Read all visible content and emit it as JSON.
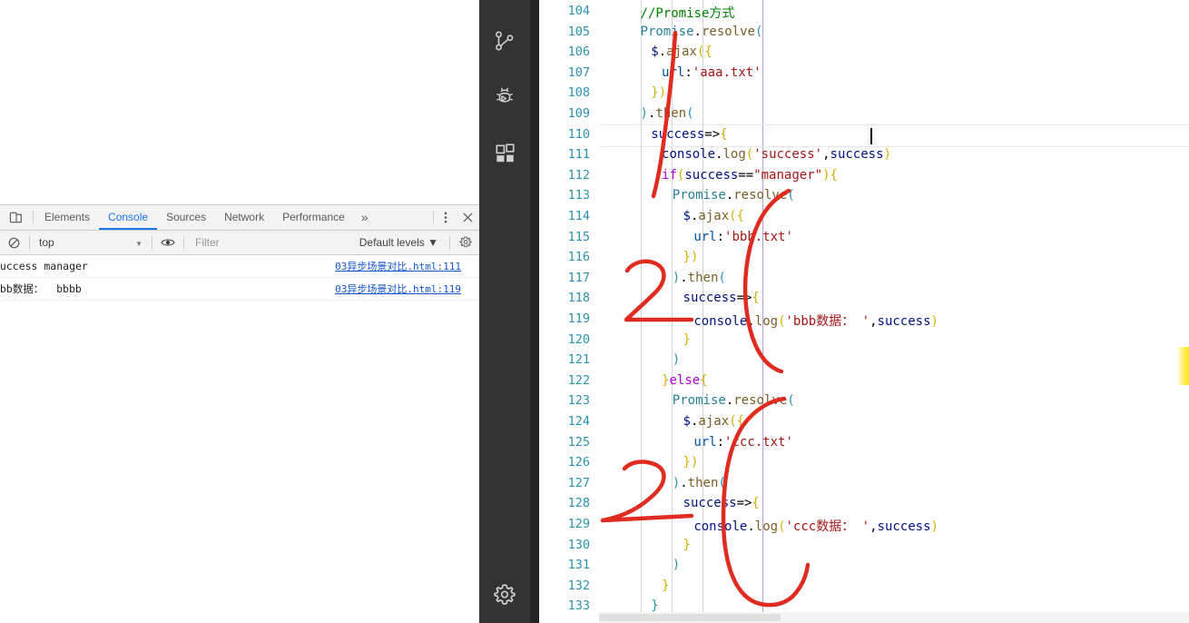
{
  "devtools": {
    "inspect_icon": "device-toolbar-icon",
    "tabs": [
      {
        "label": "Elements",
        "active": false
      },
      {
        "label": "Console",
        "active": true
      },
      {
        "label": "Sources",
        "active": false
      },
      {
        "label": "Network",
        "active": false
      },
      {
        "label": "Performance",
        "active": false
      }
    ],
    "overflow_label": "»",
    "kebab_icon": "more-vertical-icon",
    "close_icon": "close-icon",
    "filterbar": {
      "clear_icon": "clear-console-icon",
      "context": "top",
      "context_caret": "▼",
      "eye_icon": "eye-icon",
      "filter_placeholder": "Filter",
      "levels": "Default levels ▼",
      "gear_icon": "settings-gear-icon"
    },
    "messages": [
      {
        "text": "success manager",
        "source": "03异步场景对比.html:111"
      },
      {
        "text": "bbb数据：  bbbb",
        "source": "03异步场景对比.html:119"
      }
    ]
  },
  "activitybar": {
    "items": [
      {
        "name": "source-control-icon"
      },
      {
        "name": "run-and-debug-icon"
      },
      {
        "name": "extensions-icon"
      }
    ],
    "bottom": [
      {
        "name": "settings-gear-icon"
      }
    ]
  },
  "editor": {
    "first_line_number": 104,
    "line_numbers": [
      104,
      105,
      106,
      107,
      108,
      109,
      110,
      111,
      112,
      113,
      114,
      115,
      116,
      117,
      118,
      119,
      120,
      121,
      122,
      123,
      124,
      125,
      126,
      127,
      128,
      129,
      130,
      131,
      132,
      133
    ],
    "cursor_line": 110,
    "lines": [
      {
        "n": 104,
        "indent": 2,
        "tokens": [
          {
            "t": "//Promise方式",
            "c": "tk-cmt"
          }
        ]
      },
      {
        "n": 105,
        "indent": 2,
        "tokens": [
          {
            "t": "Promise",
            "c": "tk-cls"
          },
          {
            "t": ".",
            "c": "tk-plain"
          },
          {
            "t": "resolve",
            "c": "tk-fn"
          },
          {
            "t": "(",
            "c": "tk-br3"
          }
        ]
      },
      {
        "n": 106,
        "indent": 3,
        "tokens": [
          {
            "t": "$",
            "c": "tk-var"
          },
          {
            "t": ".",
            "c": "tk-plain"
          },
          {
            "t": "ajax",
            "c": "tk-fn"
          },
          {
            "t": "(",
            "c": "tk-br1"
          },
          {
            "t": "{",
            "c": "tk-br1"
          }
        ]
      },
      {
        "n": 107,
        "indent": 4,
        "tokens": [
          {
            "t": "url",
            "c": "tk-prop"
          },
          {
            "t": ":",
            "c": "tk-plain"
          },
          {
            "t": "'aaa.txt'",
            "c": "tk-str"
          }
        ]
      },
      {
        "n": 108,
        "indent": 3,
        "tokens": [
          {
            "t": "}",
            "c": "tk-br1"
          },
          {
            "t": ")",
            "c": "tk-br1"
          }
        ]
      },
      {
        "n": 109,
        "indent": 2,
        "tokens": [
          {
            "t": ")",
            "c": "tk-br3"
          },
          {
            "t": ".",
            "c": "tk-plain"
          },
          {
            "t": "then",
            "c": "tk-fn"
          },
          {
            "t": "(",
            "c": "tk-br3"
          }
        ]
      },
      {
        "n": 110,
        "indent": 3,
        "tokens": [
          {
            "t": "success",
            "c": "tk-var"
          },
          {
            "t": "=>",
            "c": "tk-op"
          },
          {
            "t": "{",
            "c": "tk-br1"
          }
        ]
      },
      {
        "n": 111,
        "indent": 4,
        "tokens": [
          {
            "t": "console",
            "c": "tk-var"
          },
          {
            "t": ".",
            "c": "tk-plain"
          },
          {
            "t": "log",
            "c": "tk-fn"
          },
          {
            "t": "(",
            "c": "tk-br1"
          },
          {
            "t": "'success'",
            "c": "tk-str"
          },
          {
            "t": ",",
            "c": "tk-plain"
          },
          {
            "t": "success",
            "c": "tk-var"
          },
          {
            "t": ")",
            "c": "tk-br1"
          }
        ]
      },
      {
        "n": 112,
        "indent": 4,
        "tokens": [
          {
            "t": "if",
            "c": "tk-ctl"
          },
          {
            "t": "(",
            "c": "tk-br1"
          },
          {
            "t": "success",
            "c": "tk-var"
          },
          {
            "t": "==",
            "c": "tk-op"
          },
          {
            "t": "\"manager\"",
            "c": "tk-str"
          },
          {
            "t": ")",
            "c": "tk-br1"
          },
          {
            "t": "{",
            "c": "tk-br1"
          }
        ]
      },
      {
        "n": 113,
        "indent": 5,
        "tokens": [
          {
            "t": "Promise",
            "c": "tk-cls"
          },
          {
            "t": ".",
            "c": "tk-plain"
          },
          {
            "t": "resolve",
            "c": "tk-fn"
          },
          {
            "t": "(",
            "c": "tk-br3"
          }
        ]
      },
      {
        "n": 114,
        "indent": 6,
        "tokens": [
          {
            "t": "$",
            "c": "tk-var"
          },
          {
            "t": ".",
            "c": "tk-plain"
          },
          {
            "t": "ajax",
            "c": "tk-fn"
          },
          {
            "t": "(",
            "c": "tk-br1"
          },
          {
            "t": "{",
            "c": "tk-br1"
          }
        ]
      },
      {
        "n": 115,
        "indent": 7,
        "tokens": [
          {
            "t": "url",
            "c": "tk-prop"
          },
          {
            "t": ":",
            "c": "tk-plain"
          },
          {
            "t": "'bbb.txt'",
            "c": "tk-str"
          }
        ]
      },
      {
        "n": 116,
        "indent": 6,
        "tokens": [
          {
            "t": "}",
            "c": "tk-br1"
          },
          {
            "t": ")",
            "c": "tk-br1"
          }
        ]
      },
      {
        "n": 117,
        "indent": 5,
        "tokens": [
          {
            "t": ")",
            "c": "tk-br3"
          },
          {
            "t": ".",
            "c": "tk-plain"
          },
          {
            "t": "then",
            "c": "tk-fn"
          },
          {
            "t": "(",
            "c": "tk-br3"
          }
        ]
      },
      {
        "n": 118,
        "indent": 6,
        "tokens": [
          {
            "t": "success",
            "c": "tk-var"
          },
          {
            "t": "=>",
            "c": "tk-op"
          },
          {
            "t": "{",
            "c": "tk-br1"
          }
        ]
      },
      {
        "n": 119,
        "indent": 7,
        "tokens": [
          {
            "t": "console",
            "c": "tk-var"
          },
          {
            "t": ".",
            "c": "tk-plain"
          },
          {
            "t": "log",
            "c": "tk-fn"
          },
          {
            "t": "(",
            "c": "tk-br1"
          },
          {
            "t": "'bbb数据： '",
            "c": "tk-str"
          },
          {
            "t": ",",
            "c": "tk-plain"
          },
          {
            "t": "success",
            "c": "tk-var"
          },
          {
            "t": ")",
            "c": "tk-br1"
          }
        ]
      },
      {
        "n": 120,
        "indent": 6,
        "tokens": [
          {
            "t": "}",
            "c": "tk-br1"
          }
        ]
      },
      {
        "n": 121,
        "indent": 5,
        "tokens": [
          {
            "t": ")",
            "c": "tk-br3"
          }
        ]
      },
      {
        "n": 122,
        "indent": 4,
        "tokens": [
          {
            "t": "}",
            "c": "tk-br1"
          },
          {
            "t": "else",
            "c": "tk-ctl"
          },
          {
            "t": "{",
            "c": "tk-br1"
          }
        ]
      },
      {
        "n": 123,
        "indent": 5,
        "tokens": [
          {
            "t": "Promise",
            "c": "tk-cls"
          },
          {
            "t": ".",
            "c": "tk-plain"
          },
          {
            "t": "resolve",
            "c": "tk-fn"
          },
          {
            "t": "(",
            "c": "tk-br3"
          }
        ]
      },
      {
        "n": 124,
        "indent": 6,
        "tokens": [
          {
            "t": "$",
            "c": "tk-var"
          },
          {
            "t": ".",
            "c": "tk-plain"
          },
          {
            "t": "ajax",
            "c": "tk-fn"
          },
          {
            "t": "(",
            "c": "tk-br1"
          },
          {
            "t": "{",
            "c": "tk-br1"
          }
        ]
      },
      {
        "n": 125,
        "indent": 7,
        "tokens": [
          {
            "t": "url",
            "c": "tk-prop"
          },
          {
            "t": ":",
            "c": "tk-plain"
          },
          {
            "t": "'ccc.txt'",
            "c": "tk-str"
          }
        ]
      },
      {
        "n": 126,
        "indent": 6,
        "tokens": [
          {
            "t": "}",
            "c": "tk-br1"
          },
          {
            "t": ")",
            "c": "tk-br1"
          }
        ]
      },
      {
        "n": 127,
        "indent": 5,
        "tokens": [
          {
            "t": ")",
            "c": "tk-br3"
          },
          {
            "t": ".",
            "c": "tk-plain"
          },
          {
            "t": "then",
            "c": "tk-fn"
          },
          {
            "t": "(",
            "c": "tk-br3"
          }
        ]
      },
      {
        "n": 128,
        "indent": 6,
        "tokens": [
          {
            "t": "success",
            "c": "tk-var"
          },
          {
            "t": "=>",
            "c": "tk-op"
          },
          {
            "t": "{",
            "c": "tk-br1"
          }
        ]
      },
      {
        "n": 129,
        "indent": 7,
        "tokens": [
          {
            "t": "console",
            "c": "tk-var"
          },
          {
            "t": ".",
            "c": "tk-plain"
          },
          {
            "t": "log",
            "c": "tk-fn"
          },
          {
            "t": "(",
            "c": "tk-br1"
          },
          {
            "t": "'ccc数据： '",
            "c": "tk-str"
          },
          {
            "t": ",",
            "c": "tk-plain"
          },
          {
            "t": "success",
            "c": "tk-var"
          },
          {
            "t": ")",
            "c": "tk-br1"
          }
        ]
      },
      {
        "n": 130,
        "indent": 6,
        "tokens": [
          {
            "t": "}",
            "c": "tk-br1"
          }
        ]
      },
      {
        "n": 131,
        "indent": 5,
        "tokens": [
          {
            "t": ")",
            "c": "tk-br3"
          }
        ]
      },
      {
        "n": 132,
        "indent": 4,
        "tokens": [
          {
            "t": "}",
            "c": "tk-br1"
          }
        ]
      },
      {
        "n": 133,
        "indent": 3,
        "tokens": [
          {
            "t": "}",
            "c": "tk-br3"
          }
        ]
      }
    ]
  },
  "annotations": {
    "marks": [
      {
        "label": "1-stroke",
        "name": "red-stroke-1"
      },
      {
        "label": "2",
        "name": "red-digit-2-upper"
      },
      {
        "label": "brace-1",
        "name": "red-bracket-upper"
      },
      {
        "label": "2",
        "name": "red-digit-2-lower"
      },
      {
        "label": "brace-2",
        "name": "red-bracket-lower"
      }
    ],
    "color": "#e02b20"
  },
  "colors": {
    "activitybar_bg": "#333333",
    "editor_bg": "#ffffff",
    "line_number": "#2b91af",
    "accent_blue": "#1a73e8",
    "ink_red": "#e02b20",
    "minimap_marker": "#ffe600"
  }
}
